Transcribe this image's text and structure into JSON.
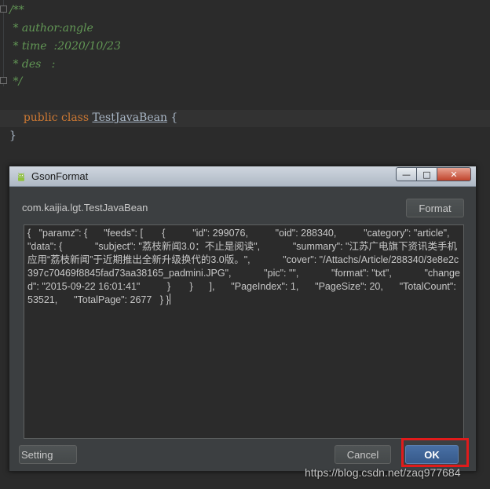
{
  "editor": {
    "lines": [
      {
        "text": "/**"
      },
      {
        "text": " * author:angle"
      },
      {
        "text": " * time  :2020/10/23"
      },
      {
        "text": " * des   :"
      },
      {
        "text": " */"
      }
    ],
    "class_decl": {
      "keyword": "public class ",
      "class_name": "TestJavaBean",
      "open_brace": " {"
    },
    "close_brace": "}"
  },
  "dialog": {
    "title": "GsonFormat",
    "icon": "android-icon",
    "window_controls": {
      "minimize": "—",
      "maximize": "□",
      "close": "✕"
    },
    "class_name": "com.kaijia.lgt.TestJavaBean",
    "format_label": "Format",
    "json_text": "{   \"paramz\": {      \"feeds\": [       {          \"id\": 299076,          \"oid\": 288340,          \"category\": \"article\",          \"data\": {            \"subject\": \"荔枝新闻3.0：不止是阅读\",            \"summary\": \"江苏广电旗下资讯类手机应用“荔枝新闻”于近期推出全新升级换代的3.0版。\",            \"cover\": \"/Attachs/Article/288340/3e8e2c397c70469f8845fad73aa38165_padmini.JPG\",            \"pic\": \"\",            \"format\": \"txt\",            \"changed\": \"2015-09-22 16:01:41\"          }       }      ],      \"PageIndex\": 1,      \"PageSize\": 20,      \"TotalCount\": 53521,      \"TotalPage\": 2677   } }",
    "setting_label": "Setting",
    "cancel_label": "Cancel",
    "ok_label": "OK",
    "highlight_color": "#e01b1b"
  },
  "watermark": "https://blog.csdn.net/zaq977684"
}
